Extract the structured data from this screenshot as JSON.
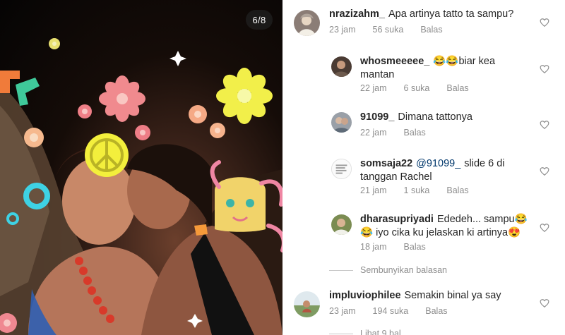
{
  "photo": {
    "counter": "6/8"
  },
  "comments": [
    {
      "username": "nrazizahm_",
      "text": "Apa artinya tatto ta sampu?",
      "time": "23 jam",
      "likes": "56 suka",
      "reply": "Balas",
      "avatar_icon": "profile-photo"
    },
    {
      "username": "whosmeeeee_",
      "text": "😂😂biar kea mantan",
      "time": "22 jam",
      "likes": "6 suka",
      "reply": "Balas",
      "avatar_icon": "profile-photo"
    },
    {
      "username": "91099_",
      "text": "Dimana tattonya",
      "time": "22 jam",
      "reply": "Balas",
      "avatar_icon": "profile-photo"
    },
    {
      "username": "somsaja22",
      "mention": "@91099_",
      "text": "slide 6 di tanggan Rachel",
      "time": "21 jam",
      "likes": "1 suka",
      "reply": "Balas",
      "avatar_icon": "profile-photo"
    },
    {
      "username": "dharasupriyadi",
      "text": "Ededeh... sampu😂 😂 iyo cika ku jelaskan ki artinya😍",
      "time": "18 jam",
      "reply": "Balas",
      "avatar_icon": "profile-photo"
    },
    {
      "username": "impluviophilee",
      "text": "Semakin binal ya say",
      "time": "23 jam",
      "likes": "194 suka",
      "reply": "Balas",
      "avatar_icon": "profile-photo"
    }
  ],
  "hide_replies": "Sembunyikan balasan",
  "more_replies": "Lihat 9 bal…",
  "colors": {
    "meta": "#8e8e8e",
    "text": "#262626",
    "mention": "#00376b"
  }
}
